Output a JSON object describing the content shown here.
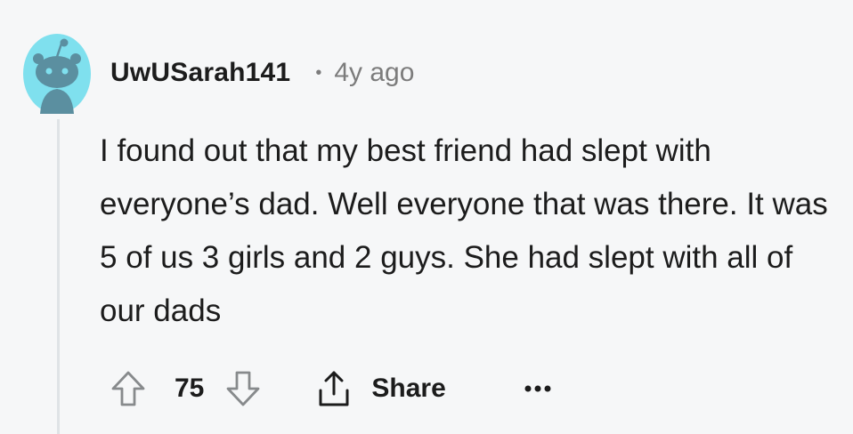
{
  "comment": {
    "author": "UwUSarah141",
    "separator": "•",
    "timestamp": "4y ago",
    "body": "I found out that my best friend had slept with everyone’s dad. Well everyone that was there. It was 5 of us 3 girls and 2 guys. She had slept with all of our dads",
    "score": "75"
  },
  "actions": {
    "share_label": "Share"
  },
  "icons": {
    "avatar": "reddit-snoo-avatar-icon",
    "upvote": "arrow-up-icon",
    "downvote": "arrow-down-icon",
    "share": "share-upload-icon",
    "more": "more-horizontal-icon"
  },
  "colors": {
    "background": "#f6f7f8",
    "avatar_bg": "#7fe0ee",
    "avatar_figure": "#5b8fa0",
    "muted_text": "#7c7c7c",
    "thread_line": "#dfe3e6"
  }
}
